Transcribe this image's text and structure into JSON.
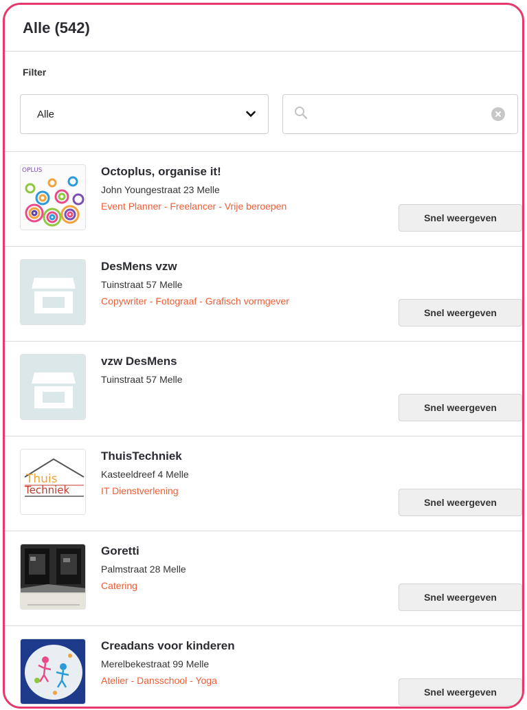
{
  "header": {
    "title": "Alle (542)"
  },
  "filter": {
    "label": "Filter",
    "select_value": "Alle",
    "search_value": "",
    "search_placeholder": ""
  },
  "colors": {
    "accent_border": "#e8386b",
    "tag_color": "#f25c33"
  },
  "items": [
    {
      "name": "Octoplus, organise it!",
      "address": "John Youngestraat 23 Melle",
      "tags": "Event Planner - Freelancer - Vrije beroepen",
      "button": "Snel weergeven",
      "thumb": "octoplus-logo",
      "thumb_text": "OPLUS"
    },
    {
      "name": "DesMens vzw",
      "address": "Tuinstraat 57 Melle",
      "tags": "Copywriter - Fotograaf - Grafisch vormgever",
      "button": "Snel weergeven",
      "thumb": "store-placeholder-icon"
    },
    {
      "name": "vzw DesMens",
      "address": "Tuinstraat 57 Melle",
      "tags": "",
      "button": "Snel weergeven",
      "thumb": "store-placeholder-icon"
    },
    {
      "name": "ThuisTechniek",
      "address": "Kasteeldreef 4 Melle",
      "tags": "IT Dienstverlening",
      "button": "Snel weergeven",
      "thumb": "thuistechniek-logo",
      "thumb_line1": "Thuis",
      "thumb_line2": "Techniek"
    },
    {
      "name": "Goretti",
      "address": "Palmstraat 28 Melle",
      "tags": "Catering",
      "button": "Snel weergeven",
      "thumb": "goretti-photo"
    },
    {
      "name": "Creadans voor kinderen",
      "address": "Merelbekestraat 99 Melle",
      "tags": "Atelier - Dansschool - Yoga",
      "button": "Snel weergeven",
      "thumb": "creadans-logo"
    }
  ]
}
